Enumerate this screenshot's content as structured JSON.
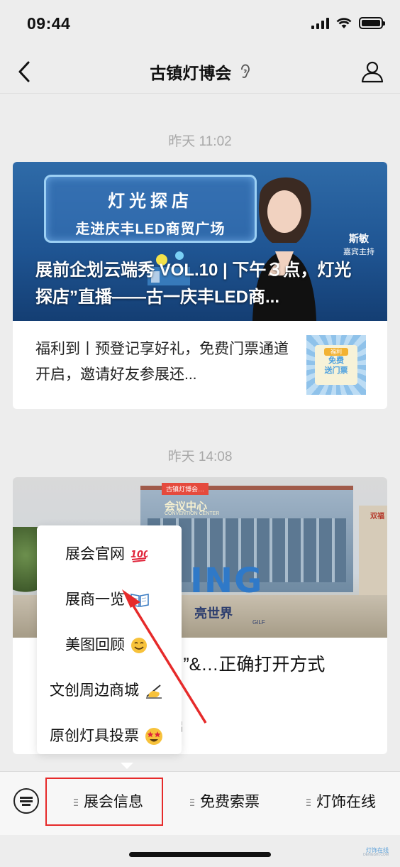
{
  "status_bar": {
    "time": "09:44"
  },
  "nav": {
    "title": "古镇灯博会"
  },
  "feed": [
    {
      "timestamp": "昨天 11:02",
      "banner": {
        "sign_line1": "灯光探店",
        "sign_line2": "走进庆丰LED商贸广场",
        "presenter_name": "斯敏",
        "presenter_role": "嘉宾主持",
        "title": "展前企划云端秀 VOL.10 | 下午３点，灯光探店”直播——古一庆丰LED商..."
      },
      "sub_item": {
        "text": "福利到丨预登记享好礼，免费门票通道开启，邀请好友参展还...",
        "thumb_tag": "福利",
        "thumb_line1": "免费",
        "thumb_line2": "送门票"
      }
    },
    {
      "timestamp": "昨天 14:08",
      "banner": {
        "ribbon": "古镇灯博会…",
        "building_sign": "会议中心",
        "building_sign_en": "CONVENTION CENTER",
        "big_letters": "ING",
        "world_text": "亮世界",
        "gilf": "GILF",
        "side_sign": "双福"
      },
      "title": "…小程序“交换名片”&…正确打开方式",
      "subtitle": "…家，双向选择由此开启"
    }
  ],
  "popup_menu": {
    "items": [
      {
        "label": "展会官网",
        "emoji": "hundred-points"
      },
      {
        "label": "展商一览",
        "emoji": "open-book"
      },
      {
        "label": "美图回顾",
        "emoji": "smiling-face"
      },
      {
        "label": "文创周边商城",
        "emoji": "writing-hand"
      },
      {
        "label": "原创灯具投票",
        "emoji": "star-struck"
      }
    ]
  },
  "bottom_menu": {
    "tabs": [
      {
        "label": "展会信息",
        "highlighted": true
      },
      {
        "label": "免费索票"
      },
      {
        "label": "灯饰在线"
      }
    ]
  },
  "watermark": {
    "line1": "灯饰在线",
    "line2": "DENGSHI.COM"
  },
  "colors": {
    "background": "#ededed",
    "highlight": "#e62a2a",
    "banner_blue": "#1f5593"
  }
}
